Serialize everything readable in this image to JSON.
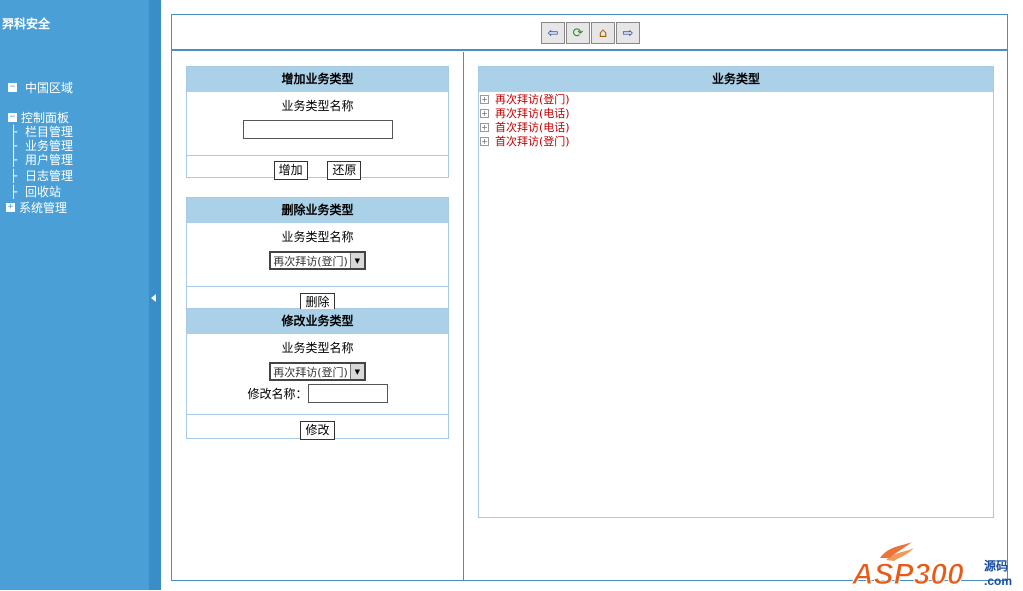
{
  "sidebar": {
    "brand": "羿科安全",
    "region": "中国区域",
    "control_panel": "控制面板",
    "control_children": [
      "栏目管理",
      "业务管理",
      "用户管理",
      "日志管理",
      "回收站"
    ],
    "system": "系统管理",
    "expanded_icon": "−",
    "collapsed_icon": "+"
  },
  "toolbar": {
    "buttons": [
      "back-icon",
      "refresh-icon",
      "home-icon",
      "forward-icon"
    ]
  },
  "add_panel": {
    "title": "增加业务类型",
    "field_label": "业务类型名称",
    "field_value": "",
    "add_label": "增加",
    "reset_label": "还原"
  },
  "delete_panel": {
    "title": "删除业务类型",
    "field_label": "业务类型名称",
    "select_value": "再次拜访(登门)",
    "delete_label": "删除"
  },
  "modify_panel": {
    "title": "修改业务类型",
    "field_label": "业务类型名称",
    "select_value": "再次拜访(登门)",
    "rename_label": "修改名称：",
    "rename_value": "",
    "modify_label": "修改"
  },
  "type_panel": {
    "title": "业务类型",
    "items": [
      "再次拜访(登门)",
      "再次拜访(电话)",
      "首次拜访(电话)",
      "首次拜访(登门)"
    ]
  },
  "logo": {
    "text": "ASP300",
    "suffix_cn": "源码",
    "suffix_en": ".com"
  },
  "colors": {
    "sidebar": "#4a9fd6",
    "header": "#abd1e9",
    "link": "#c00000",
    "logo": "#e85a16"
  }
}
